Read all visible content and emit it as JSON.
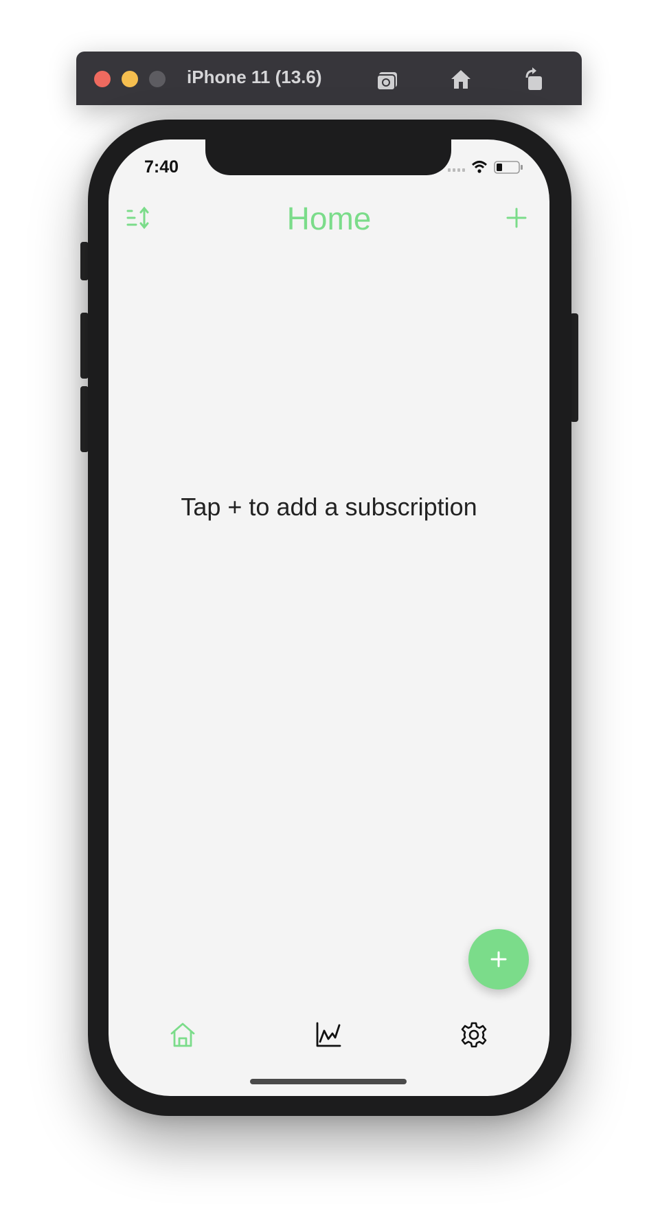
{
  "window": {
    "title": "iPhone 11 (13.6)"
  },
  "status_bar": {
    "time": "7:40"
  },
  "nav": {
    "title": "Home"
  },
  "main": {
    "empty_message": "Tap + to add a subscription"
  },
  "colors": {
    "accent": "#7bdc8a",
    "background": "#f4f4f4",
    "text": "#222222"
  },
  "icons": {
    "nav_left": "sort-icon",
    "nav_right": "plus-icon",
    "fab": "plus-icon",
    "tabs": [
      "home-icon",
      "chart-icon",
      "gear-icon"
    ]
  },
  "tabs": [
    {
      "name": "home",
      "active": true
    },
    {
      "name": "stats",
      "active": false
    },
    {
      "name": "settings",
      "active": false
    }
  ]
}
